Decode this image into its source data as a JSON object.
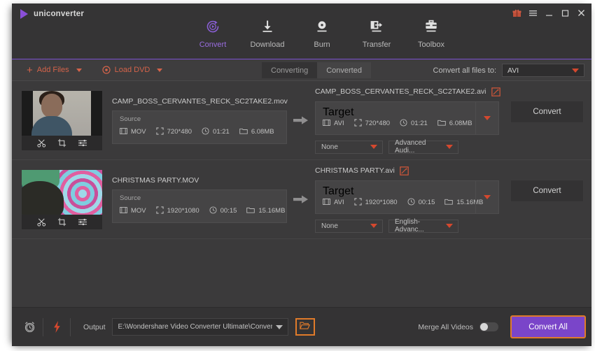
{
  "app": {
    "brand": "uniconverter",
    "logo_icon": "play-triangle-icon"
  },
  "window_controls": [
    {
      "name": "gift-icon",
      "glyph": "gift"
    },
    {
      "name": "menu-icon",
      "glyph": "hamburger"
    },
    {
      "name": "minimize-icon",
      "glyph": "minimize"
    },
    {
      "name": "maximize-icon",
      "glyph": "maximize"
    },
    {
      "name": "close-icon",
      "glyph": "close"
    }
  ],
  "nav": {
    "active": "Convert",
    "tabs": [
      {
        "label": "Convert",
        "icon": "convert-circular-play-icon"
      },
      {
        "label": "Download",
        "icon": "download-arrow-icon"
      },
      {
        "label": "Burn",
        "icon": "burn-disc-icon"
      },
      {
        "label": "Transfer",
        "icon": "transfer-device-arrow-icon"
      },
      {
        "label": "Toolbox",
        "icon": "toolbox-icon"
      }
    ]
  },
  "toolbar": {
    "add_files_label": "Add Files",
    "add_files_icon": "plus-icon",
    "load_dvd_label": "Load DVD",
    "load_dvd_icon": "disc-icon",
    "segments": [
      {
        "label": "Converting",
        "active": true
      },
      {
        "label": "Converted",
        "active": false
      }
    ],
    "convert_all_to_label": "Convert all files to:",
    "convert_all_to_value": "AVI"
  },
  "rows": [
    {
      "source_filename": "CAMP_BOSS_CERVANTES_RECK_SC2TAKE2.mov",
      "source_box_label": "Source",
      "source_format": "MOV",
      "source_resolution": "720*480",
      "source_duration": "01:21",
      "source_size": "6.08MB",
      "target_filename": "CAMP_BOSS_CERVANTES_RECK_SC2TAKE2.avi",
      "target_box_label": "Target",
      "target_format": "AVI",
      "target_resolution": "720*480",
      "target_duration": "01:21",
      "target_size": "6.08MB",
      "subtitle_select": "None",
      "audio_select": "Advanced Audi...",
      "convert_button": "Convert"
    },
    {
      "source_filename": "CHRISTMAS PARTY.MOV",
      "source_box_label": "Source",
      "source_format": "MOV",
      "source_resolution": "1920*1080",
      "source_duration": "00:15",
      "source_size": "15.16MB",
      "target_filename": "CHRISTMAS PARTY.avi",
      "target_box_label": "Target",
      "target_format": "AVI",
      "target_resolution": "1920*1080",
      "target_duration": "00:15",
      "target_size": "15.16MB",
      "subtitle_select": "None",
      "audio_select": "English-Advanc...",
      "convert_button": "Convert"
    }
  ],
  "thumb_tools": [
    {
      "name": "trim-scissors-icon"
    },
    {
      "name": "crop-icon"
    },
    {
      "name": "effect-sliders-icon"
    }
  ],
  "bottom": {
    "timer_icon": "alarm-clock-icon",
    "speed_icon": "lightning-bolt-icon",
    "output_label": "Output",
    "output_path": "E:\\Wondershare Video Converter Ultimate\\Converted",
    "folder_icon": "open-folder-icon",
    "merge_label": "Merge All Videos",
    "merge_enabled": false,
    "convert_all_label": "Convert All"
  },
  "colors": {
    "accent_purple": "#7a45c9",
    "accent_orange": "#e07b2a",
    "accent_red": "#d4482e",
    "app_bg": "#3b3a3b",
    "topbar_bg": "#353435"
  }
}
